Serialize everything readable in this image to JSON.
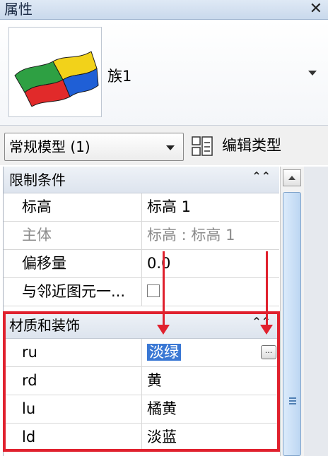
{
  "window": {
    "title": "属性",
    "close_glyph": "✕"
  },
  "family": {
    "name": "族1"
  },
  "type_selector": {
    "value": "常规模型 (1)",
    "edit_type_label": "编辑类型"
  },
  "groups": {
    "constraints": {
      "label": "限制条件",
      "collapse_glyph": "⌃⌃"
    },
    "materials": {
      "label": "材质和装饰",
      "collapse_glyph": "⌃⌃"
    }
  },
  "constraints_rows": [
    {
      "key": "标高",
      "value": "标高 1"
    },
    {
      "key": "主体",
      "value": "标高 : 标高 1"
    },
    {
      "key": "偏移量",
      "value": "0.0"
    },
    {
      "key": "与邻近图元一...",
      "value": ""
    }
  ],
  "material_rows": [
    {
      "key": "ru",
      "value": "淡绿"
    },
    {
      "key": "rd",
      "value": "黄"
    },
    {
      "key": "lu",
      "value": "橘黄"
    },
    {
      "key": "ld",
      "value": "淡蓝"
    }
  ],
  "more_button_label": "...",
  "colors": {
    "annotation_red": "#e0212e",
    "selection_blue": "#3a78d4"
  }
}
